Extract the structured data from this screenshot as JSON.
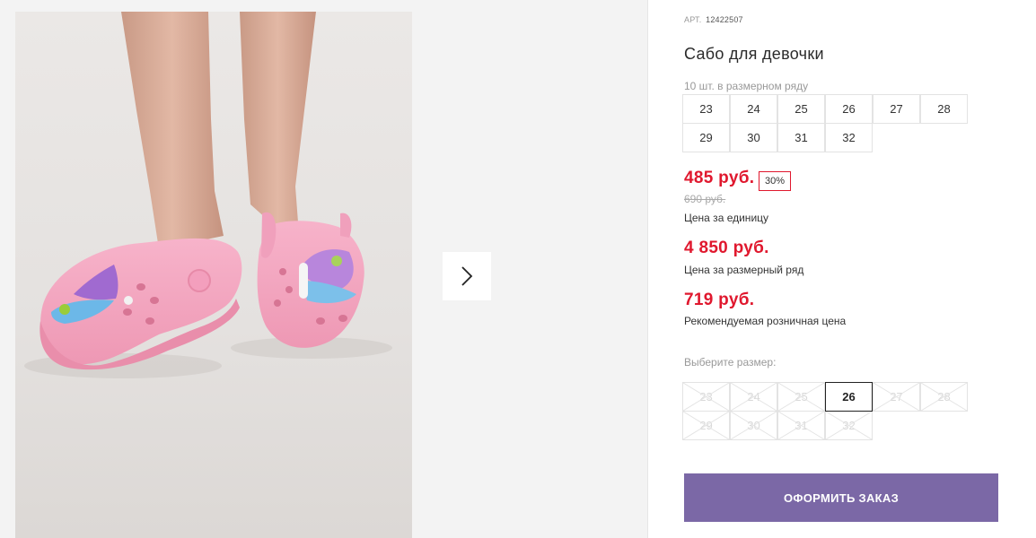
{
  "product": {
    "art_label": "АРТ.",
    "art_number": "12422507",
    "title": "Сабо для девочки",
    "count_text": "10 шт. в размерном ряду",
    "sizes_row": [
      "23",
      "24",
      "25",
      "26",
      "27",
      "28",
      "29",
      "30",
      "31",
      "32"
    ]
  },
  "pricing": {
    "price": "485 руб.",
    "discount": "30%",
    "old_price": "690 руб.",
    "unit_caption": "Цена за единицу",
    "row_price": "4 850 руб.",
    "row_caption": "Цена за размерный ряд",
    "retail_price": "719 руб.",
    "retail_caption": "Рекомендуемая розничная цена"
  },
  "size_select": {
    "label": "Выберите размер:",
    "options": [
      {
        "size": "23",
        "available": false
      },
      {
        "size": "24",
        "available": false
      },
      {
        "size": "25",
        "available": false
      },
      {
        "size": "26",
        "available": true,
        "selected": true
      },
      {
        "size": "27",
        "available": false
      },
      {
        "size": "28",
        "available": false
      },
      {
        "size": "29",
        "available": false
      },
      {
        "size": "30",
        "available": false
      },
      {
        "size": "31",
        "available": false
      },
      {
        "size": "32",
        "available": false
      }
    ]
  },
  "actions": {
    "order_label": "ОФОРМИТЬ ЗАКАЗ",
    "next_icon": "chevron-right-icon"
  },
  "colors": {
    "accent_price": "#e0182e",
    "order_button": "#7b68a6"
  }
}
